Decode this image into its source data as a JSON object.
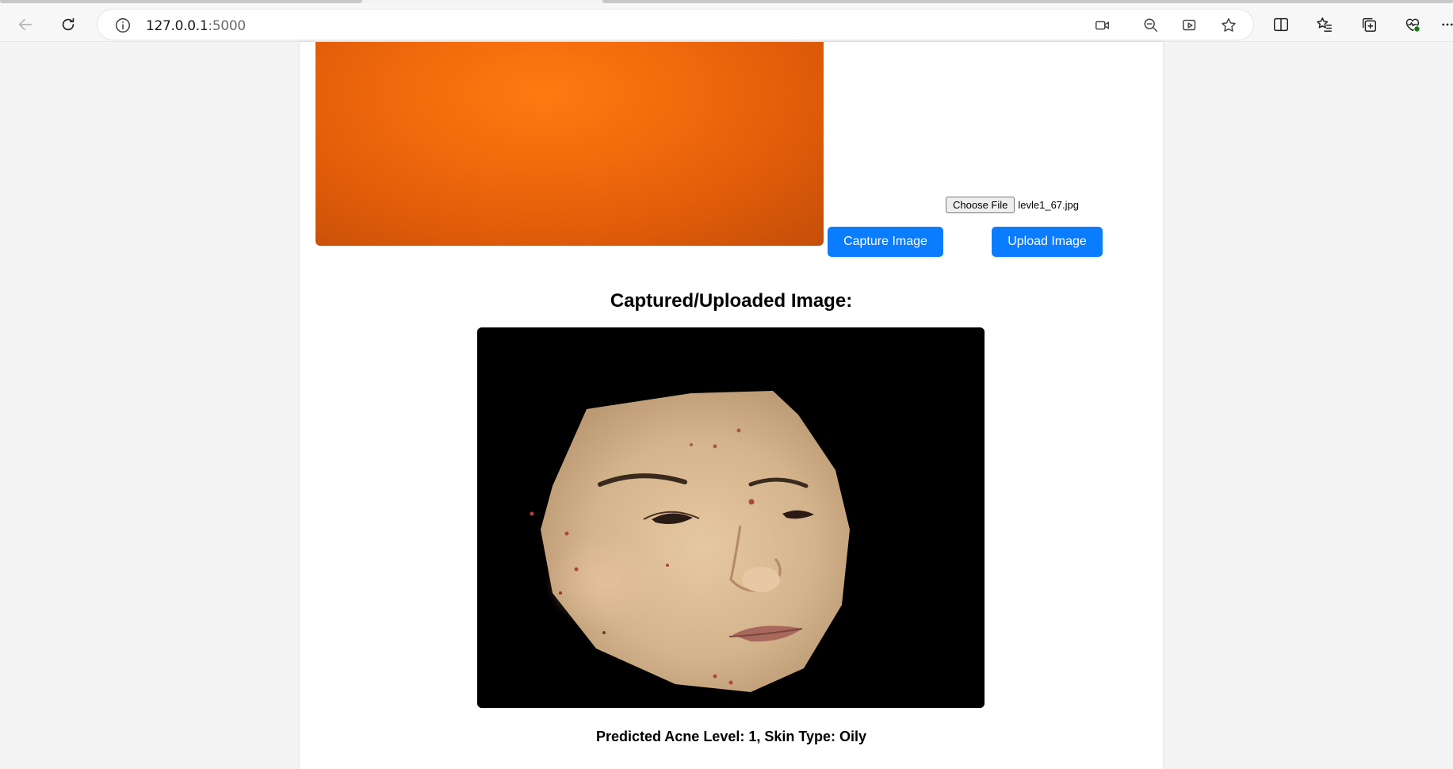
{
  "browser": {
    "url_host": "127.0.0.1",
    "url_port": ":5000",
    "toolbar_icons": [
      "back-icon",
      "refresh-icon",
      "info-icon",
      "camera-icon",
      "zoom-out-icon",
      "immersive-reader-icon",
      "favorite-star-icon",
      "split-screen-icon",
      "favorites-icon",
      "collections-icon",
      "browser-essentials-icon",
      "more-icon"
    ]
  },
  "page": {
    "file_button_label": "Choose File",
    "file_name": "levle1_67.jpg",
    "capture_button_label": "Capture Image",
    "upload_button_label": "Upload Image",
    "image_heading": "Captured/Uploaded Image:",
    "prediction_text": "Predicted Acne Level: 1, Skin Type: Oily"
  },
  "colors": {
    "button_blue": "#0a7cff",
    "video_orange": "#f26a0c",
    "page_bg": "#f4f4f4"
  }
}
